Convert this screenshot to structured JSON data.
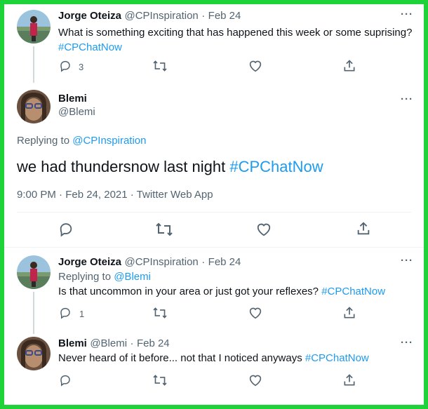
{
  "tweet1": {
    "name": "Jorge Oteiza",
    "handle": "@CPInspiration",
    "sep": "·",
    "date": "Feb 24",
    "text": "What is something exciting that has happened this week or some suprising?",
    "hashtag": "#CPChatNow",
    "replies": "3"
  },
  "main": {
    "name": "Blemi",
    "handle": "@Blemi",
    "replying_prefix": "Replying to",
    "replying_to": "@CPInspiration",
    "text": "we had thundersnow last night",
    "hashtag": "#CPChatNow",
    "meta": "9:00 PM · Feb 24, 2021 · Twitter Web App"
  },
  "reply1": {
    "name": "Jorge Oteiza",
    "handle": "@CPInspiration",
    "sep": "·",
    "date": "Feb 24",
    "replying_prefix": "Replying to",
    "replying_to": "@Blemi",
    "text": "Is that uncommon in your area or just got your reflexes?",
    "hashtag": "#CPChatNow",
    "replies": "1"
  },
  "reply2": {
    "name": "Blemi",
    "handle": "@Blemi",
    "sep": "·",
    "date": "Feb 24",
    "text": "Never heard of it before... not that I noticed anyways",
    "hashtag": "#CPChatNow"
  },
  "more_label": "···",
  "icons": [
    "reply-icon",
    "retweet-icon",
    "like-icon",
    "share-icon",
    "more-icon"
  ],
  "colors": {
    "border": "#1ed33a",
    "link": "#1d9bf0",
    "muted": "#536471"
  }
}
